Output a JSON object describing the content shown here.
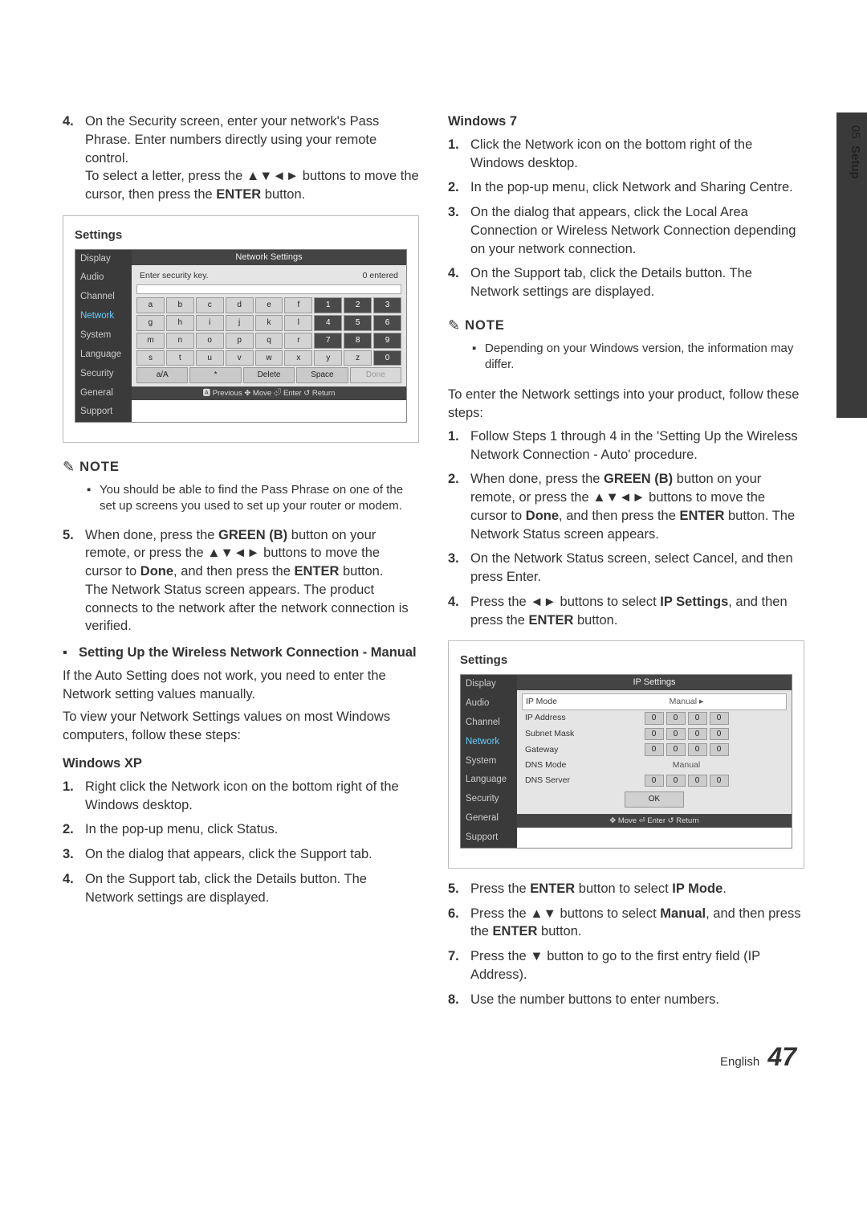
{
  "sideTab": {
    "chapter": "05",
    "title": "Setup"
  },
  "footer": {
    "lang": "English",
    "page": "47"
  },
  "left": {
    "step4": {
      "num": "4.",
      "body_parts": [
        "On the Security screen, enter your network's Pass Phrase. Enter numbers directly using your remote control.",
        "To select a letter, press the ▲▼◄► buttons to move the cursor, then press the ",
        "ENTER",
        " button."
      ]
    },
    "ui1": {
      "title": "Settings",
      "panel_title": "Network Settings",
      "side": [
        "Display",
        "Audio",
        "Channel",
        "Network",
        "System",
        "Language",
        "Security",
        "General",
        "Support"
      ],
      "active": "Network",
      "prompt": "Enter security key.",
      "counter": "0 entered",
      "rows": [
        [
          "a",
          "b",
          "c",
          "d",
          "e",
          "f",
          "1",
          "2",
          "3"
        ],
        [
          "g",
          "h",
          "i",
          "j",
          "k",
          "l",
          "4",
          "5",
          "6"
        ],
        [
          "m",
          "n",
          "o",
          "p",
          "q",
          "r",
          "7",
          "8",
          "9"
        ],
        [
          "s",
          "t",
          "u",
          "v",
          "w",
          "x",
          "y",
          "z",
          "0"
        ]
      ],
      "wide": [
        "a/A",
        "*",
        "Delete",
        "Space",
        "Done"
      ],
      "foot": "🅰 Previous   ✥ Move   ⏎ Enter   ↺ Return"
    },
    "note1": {
      "label": "NOTE",
      "body": "You should be able to find the Pass Phrase on one of the set up screens you used to set up your router or modem."
    },
    "step5": {
      "num": "5.",
      "parts": [
        "When done, press the ",
        "GREEN (B)",
        " button on your remote, or press the ▲▼◄► buttons to move the cursor to ",
        "Done",
        ", and then press the ",
        "ENTER",
        " button."
      ],
      "tail": "The Network Status screen appears. The product connects to the network after the network connection is verified."
    },
    "sub": {
      "bullet": "▪",
      "text": "Setting Up the Wireless Network Connection - Manual"
    },
    "para1": "If the Auto Setting does not work, you need to enter the Network setting values manually.",
    "para2": "To view your Network Settings values on most Windows computers, follow these steps:",
    "xp": {
      "head": "Windows XP",
      "items": [
        {
          "n": "1.",
          "t": "Right click the Network icon on the bottom right of the Windows desktop."
        },
        {
          "n": "2.",
          "t": "In the pop-up menu, click Status."
        },
        {
          "n": "3.",
          "t": "On the dialog that appears, click the Support tab."
        },
        {
          "n": "4.",
          "t": "On the Support tab, click the Details button. The Network settings are displayed."
        }
      ]
    }
  },
  "right": {
    "w7": {
      "head": "Windows 7",
      "items": [
        {
          "n": "1.",
          "t": "Click the Network icon on the bottom right of the Windows desktop."
        },
        {
          "n": "2.",
          "t": "In the pop-up menu, click Network and Sharing Centre."
        },
        {
          "n": "3.",
          "t": "On the dialog that appears, click the Local Area Connection or Wireless Network Connection depending on your network connection."
        },
        {
          "n": "4.",
          "t": "On the Support tab, click the Details button. The Network settings are displayed."
        }
      ]
    },
    "note2": {
      "label": "NOTE",
      "body": "Depending on your Windows version, the information may differ."
    },
    "para3": "To enter the Network settings into your product, follow these steps:",
    "steps2": [
      {
        "n": "1.",
        "t": "Follow Steps 1 through 4 in the 'Setting Up the Wireless Network Connection - Auto' procedure."
      },
      {
        "n": "2.",
        "parts": [
          "When done, press the ",
          "GREEN (B)",
          " button on your remote, or press the ▲▼◄► buttons to move the cursor to ",
          "Done",
          ", and then press the ",
          "ENTER",
          " button. The Network Status screen appears."
        ]
      },
      {
        "n": "3.",
        "t": "On the Network Status screen, select Cancel, and then press Enter."
      },
      {
        "n": "4.",
        "parts": [
          "Press the ◄► buttons to select ",
          "IP Settings",
          ", and then press the ",
          "ENTER",
          " button."
        ]
      }
    ],
    "ui2": {
      "title": "Settings",
      "panel_title": "IP Settings",
      "side": [
        "Display",
        "Audio",
        "Channel",
        "Network",
        "System",
        "Language",
        "Security",
        "General",
        "Support"
      ],
      "active": "Network",
      "fields": [
        {
          "label": "IP Mode",
          "type": "dropdown",
          "value": "Manual"
        },
        {
          "label": "IP Address",
          "type": "oct",
          "oct": [
            "0",
            "0",
            "0",
            "0"
          ]
        },
        {
          "label": "Subnet Mask",
          "type": "oct",
          "oct": [
            "0",
            "0",
            "0",
            "0"
          ]
        },
        {
          "label": "Gateway",
          "type": "oct",
          "oct": [
            "0",
            "0",
            "0",
            "0"
          ]
        },
        {
          "label": "DNS Mode",
          "type": "text",
          "value": "Manual"
        },
        {
          "label": "DNS Server",
          "type": "oct",
          "oct": [
            "0",
            "0",
            "0",
            "0"
          ]
        }
      ],
      "ok": "OK",
      "foot": "✥ Move   ⏎ Enter   ↺ Return"
    },
    "steps3": [
      {
        "n": "5.",
        "parts": [
          "Press the ",
          "ENTER",
          " button to select ",
          "IP Mode",
          "."
        ]
      },
      {
        "n": "6.",
        "parts": [
          "Press the ▲▼ buttons to select ",
          "Manual",
          ", and then press the ",
          "ENTER",
          " button."
        ]
      },
      {
        "n": "7.",
        "t": "Press the ▼ button to go to the first entry field (IP Address)."
      },
      {
        "n": "8.",
        "t": "Use the number buttons to enter numbers."
      }
    ]
  }
}
